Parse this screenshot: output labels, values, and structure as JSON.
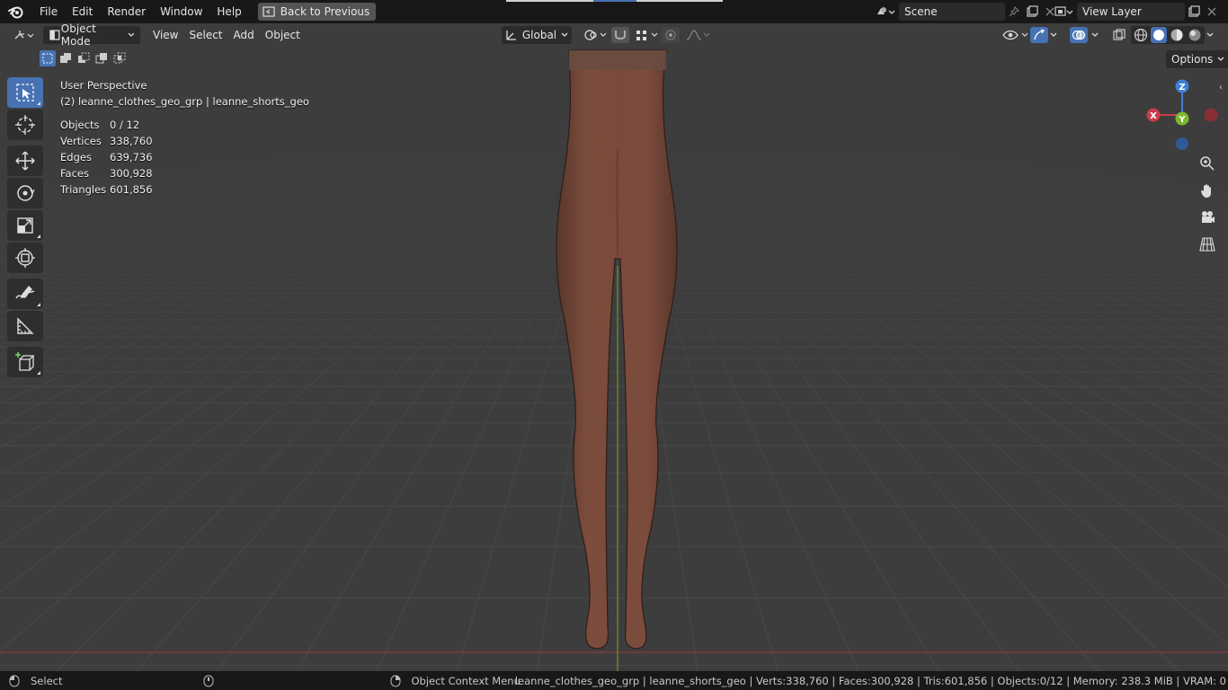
{
  "topbar": {
    "menus": [
      "File",
      "Edit",
      "Render",
      "Window",
      "Help"
    ],
    "back_button": "Back to Previous",
    "scene": "Scene",
    "view_layer": "View Layer"
  },
  "header": {
    "mode": "Object Mode",
    "menus": [
      "View",
      "Select",
      "Add",
      "Object"
    ],
    "orientation": "Global",
    "options": "Options"
  },
  "overlay": {
    "view_name": "User Perspective",
    "object_path": "(2) leanne_clothes_geo_grp | leanne_shorts_geo",
    "stats": [
      {
        "label": "Objects",
        "value": "0 / 12"
      },
      {
        "label": "Vertices",
        "value": "338,760"
      },
      {
        "label": "Edges",
        "value": "639,736"
      },
      {
        "label": "Faces",
        "value": "300,928"
      },
      {
        "label": "Triangles",
        "value": "601,856"
      }
    ]
  },
  "gizmo": {
    "x": "X",
    "y": "Y",
    "z": "Z"
  },
  "statusbar": {
    "left_action": "Select",
    "right_action": "Object Context Menu",
    "stats": "leanne_clothes_geo_grp | leanne_shorts_geo | Verts:338,760 | Faces:300,928 | Tris:601,856 | Objects:0/12 | Memory: 238.3 MiB | VRAM: 0"
  },
  "colors": {
    "accent": "#4772b3",
    "x_axis": "#c93d4a",
    "y_axis": "#7cb82f",
    "z_axis": "#3d7fd6",
    "skin": "#7b4a3b"
  }
}
